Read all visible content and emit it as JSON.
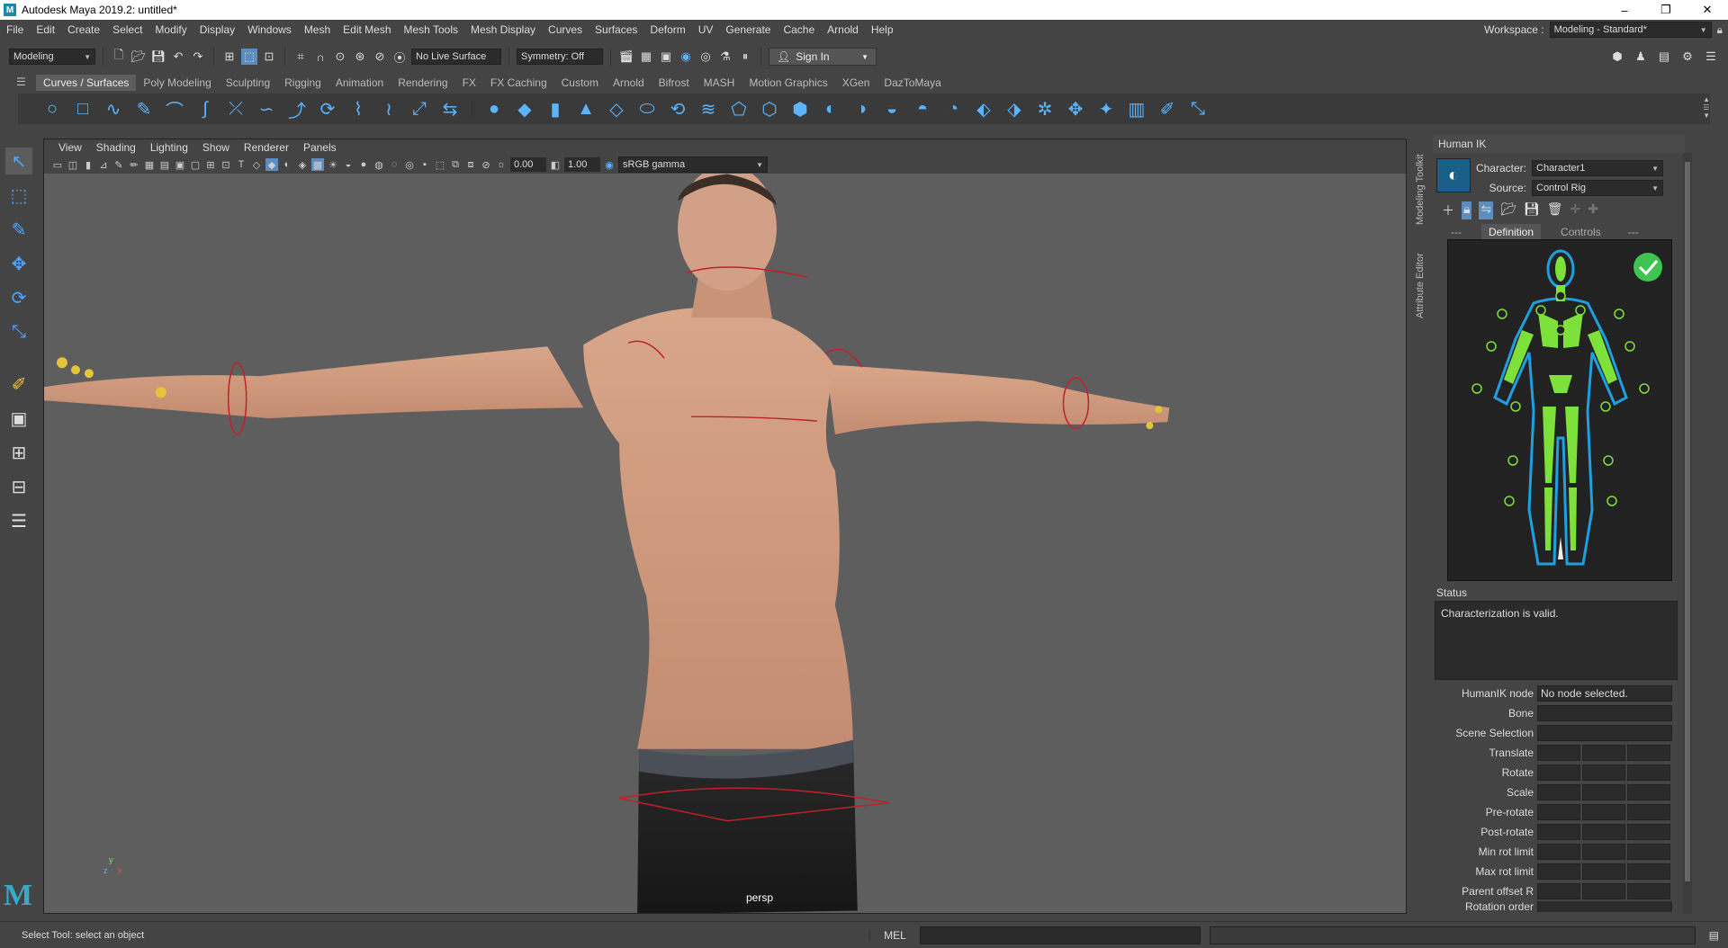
{
  "window": {
    "title": "Autodesk Maya 2019.2: untitled*",
    "app_icon": "M",
    "minimize": "–",
    "restore": "❐",
    "close": "✕"
  },
  "menu": [
    "File",
    "Edit",
    "Create",
    "Select",
    "Modify",
    "Display",
    "Windows",
    "Mesh",
    "Edit Mesh",
    "Mesh Tools",
    "Mesh Display",
    "Curves",
    "Surfaces",
    "Deform",
    "UV",
    "Generate",
    "Cache",
    "Arnold",
    "Help"
  ],
  "workspace": {
    "label": "Workspace :",
    "value": "Modeling - Standard*"
  },
  "statusline": {
    "mode": "Modeling",
    "live_surface": "No Live Surface",
    "symmetry": "Symmetry: Off",
    "sign_in": "Sign In"
  },
  "shelf_tabs": [
    "Curves / Surfaces",
    "Poly Modeling",
    "Sculpting",
    "Rigging",
    "Animation",
    "Rendering",
    "FX",
    "FX Caching",
    "Custom",
    "Arnold",
    "Bifrost",
    "MASH",
    "Motion Graphics",
    "XGen",
    "DazToMaya"
  ],
  "shelf_active": "Curves / Surfaces",
  "viewport": {
    "menu": [
      "View",
      "Shading",
      "Lighting",
      "Show",
      "Renderer",
      "Panels"
    ],
    "exposure": "0.00",
    "gamma": "1.00",
    "color_space": "sRGB gamma",
    "camera": "persp",
    "axis_x": "x",
    "axis_y": "y",
    "axis_z": "z"
  },
  "side_tabs": {
    "modeling_toolkit": "Modeling Toolkit",
    "attribute_editor": "Attribute Editor"
  },
  "humanik": {
    "title": "Human IK",
    "character_label": "Character:",
    "character_value": "Character1",
    "source_label": "Source:",
    "source_value": "Control Rig",
    "tabs": [
      "---",
      "Definition",
      "Controls",
      "---"
    ],
    "active_tab": "Definition",
    "status_label": "Status",
    "status_text": "Characterization is valid.",
    "node_label": "HumanIK node",
    "node_value": "No node selected.",
    "props": [
      "Bone",
      "Scene Selection",
      "Translate",
      "Rotate",
      "Scale",
      "Pre-rotate",
      "Post-rotate",
      "Min rot limit",
      "Max rot limit",
      "Parent offset R",
      "Rotation order"
    ],
    "valid_color": "#3ec44f",
    "figure_color": "#7ee03a",
    "outline_color": "#1e9fe0"
  },
  "helpline": {
    "text": "Select Tool: select an object",
    "language": "MEL"
  }
}
